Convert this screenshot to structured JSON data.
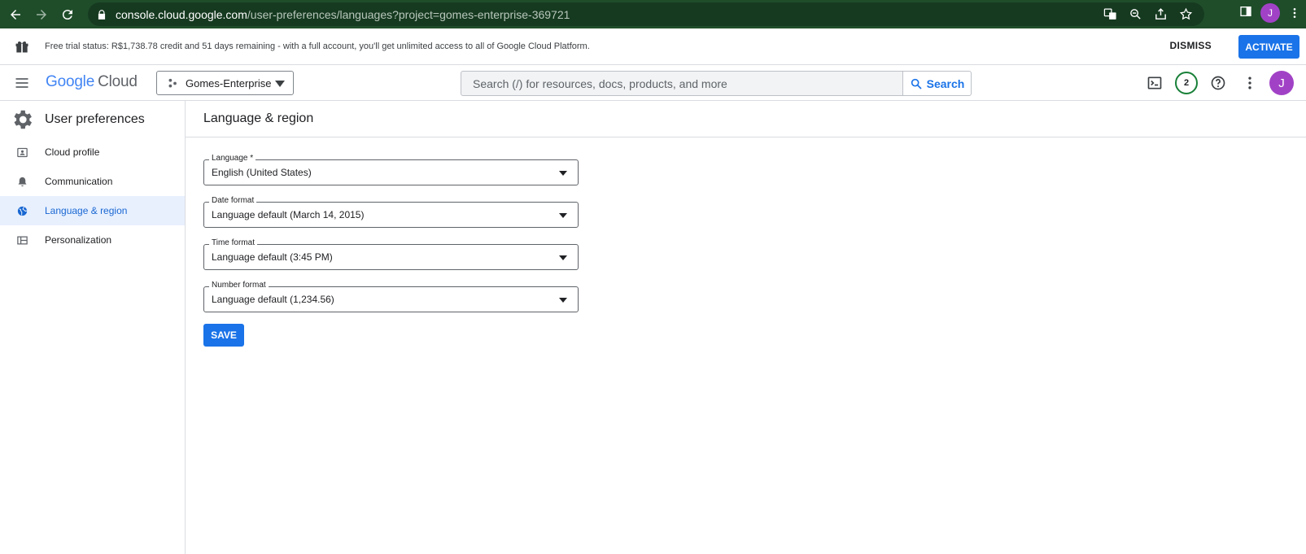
{
  "browser": {
    "url_host": "console.cloud.google.com",
    "url_path": "/user-preferences/languages?project=gomes-enterprise-369721",
    "profile_initial": "J"
  },
  "banner": {
    "message": "Free trial status: R$1,738.78 credit and 51 days remaining - with a full account, you'll get unlimited access to all of Google Cloud Platform.",
    "dismiss_label": "DISMISS",
    "activate_label": "ACTIVATE"
  },
  "appbar": {
    "logo_google": "Google",
    "logo_cloud": "Cloud",
    "project_name": "Gomes-Enterprise",
    "search_placeholder": "Search (/) for resources, docs, products, and more",
    "search_button": "Search",
    "notification_count": "2",
    "avatar_initial": "J"
  },
  "sidebar": {
    "title": "User preferences",
    "items": [
      {
        "label": "Cloud profile",
        "icon": "profile-card-icon"
      },
      {
        "label": "Communication",
        "icon": "bell-icon"
      },
      {
        "label": "Language & region",
        "icon": "globe-icon",
        "active": true
      },
      {
        "label": "Personalization",
        "icon": "layout-icon"
      }
    ]
  },
  "main": {
    "title": "Language & region",
    "fields": [
      {
        "label": "Language *",
        "value": "English (United States)"
      },
      {
        "label": "Date format",
        "value": "Language default (March 14, 2015)"
      },
      {
        "label": "Time format",
        "value": "Language default (3:45 PM)"
      },
      {
        "label": "Number format",
        "value": "Language default (1,234.56)"
      }
    ],
    "save_label": "SAVE"
  },
  "colors": {
    "accent": "#1a73e8",
    "chrome_bar": "#1f4d2a",
    "avatar": "#a142c6",
    "active_bg": "#e8f0fe"
  }
}
